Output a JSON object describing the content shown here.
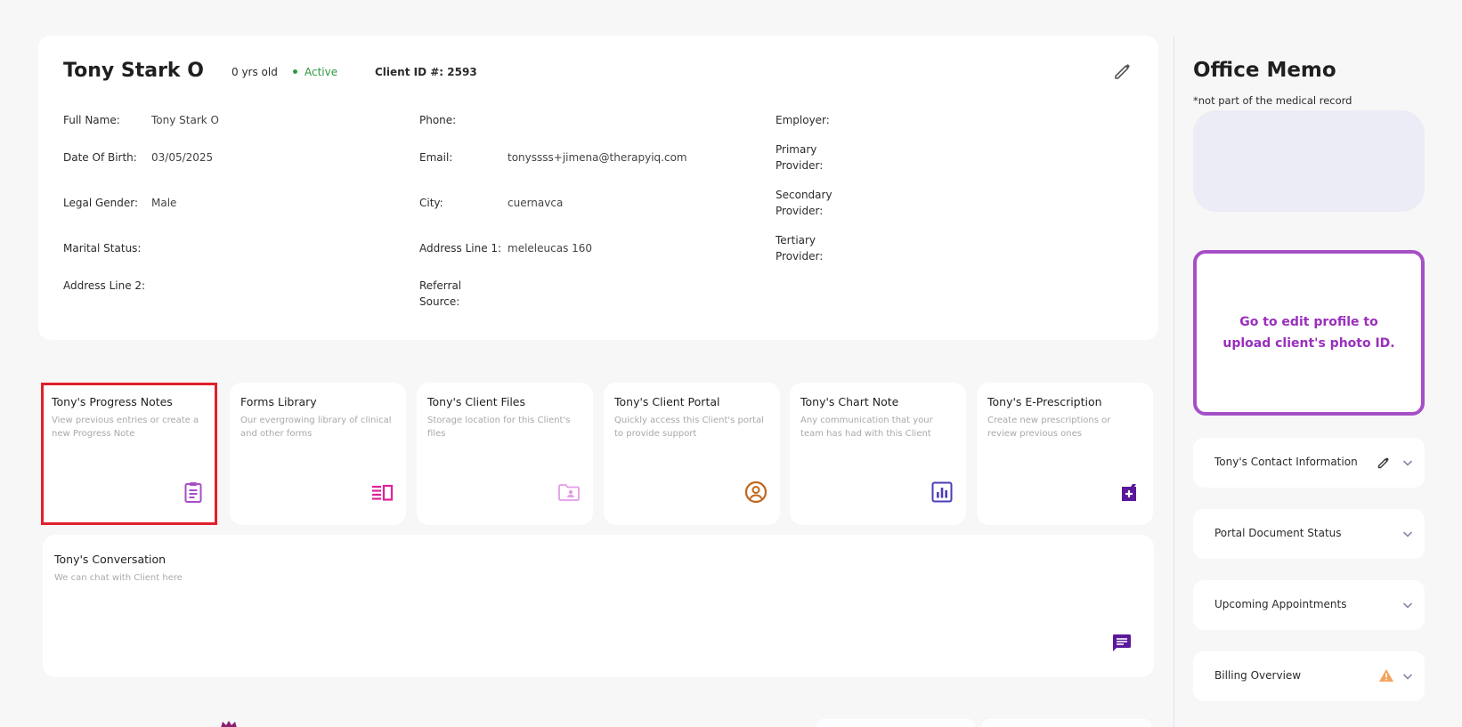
{
  "client": {
    "name": "Tony Stark O",
    "age": "0 yrs old",
    "status": "Active",
    "client_id_label": "Client ID #:",
    "client_id": "2593"
  },
  "fields": {
    "col1": [
      {
        "label": "Full Name:",
        "value": "Tony Stark O"
      },
      {
        "label": "Date Of Birth:",
        "value": "03/05/2025"
      },
      {
        "label": "Legal Gender:",
        "value": "Male"
      },
      {
        "label": "Marital Status:",
        "value": ""
      },
      {
        "label": "Address Line 2:",
        "value": ""
      }
    ],
    "col2": [
      {
        "label": "Phone:",
        "value": ""
      },
      {
        "label": "Email:",
        "value": "tonyssss+jimena@therapyiq.com"
      },
      {
        "label": "City:",
        "value": "cuernavca"
      },
      {
        "label": "Address Line 1:",
        "value": "meleleucas 160"
      },
      {
        "label": "Referral Source:",
        "value": ""
      }
    ],
    "col3": [
      {
        "label": "Employer:",
        "value": ""
      },
      {
        "label": "Primary\nProvider:",
        "value": ""
      },
      {
        "label": "Secondary\nProvider:",
        "value": ""
      },
      {
        "label": "Tertiary\nProvider:",
        "value": ""
      }
    ]
  },
  "tiles": [
    {
      "title": "Tony's Progress Notes",
      "desc": "View previous entries or create a new Progress Note",
      "icon": "clipboard-icon",
      "color": "#a64fc6"
    },
    {
      "title": "Forms Library",
      "desc": "Our evergrowing library of clinical and other forms",
      "icon": "forms-icon",
      "color": "#e0209a"
    },
    {
      "title": "Tony's Client Files",
      "desc": "Storage location for this Client's files",
      "icon": "folder-icon",
      "color": "#e49ce6"
    },
    {
      "title": "Tony's Client Portal",
      "desc": "Quickly access this Client's portal to provide support",
      "icon": "user-circle-icon",
      "color": "#c0661a"
    },
    {
      "title": "Tony's Chart Note",
      "desc": "Any communication that your team has had with this Client",
      "icon": "chart-icon",
      "color": "#4a3dbb"
    },
    {
      "title": "Tony's E-Prescription",
      "desc": "Create new prescriptions or review previous ones",
      "icon": "prescription-icon",
      "color": "#5a189a"
    }
  ],
  "conversation": {
    "title": "Tony's Conversation",
    "desc": "We can chat with Client here",
    "icon": "chat-icon",
    "color": "#5a189a"
  },
  "memo": {
    "title": "Office Memo",
    "note": "*not part of the medical record"
  },
  "photo": {
    "text": "Go to edit profile to upload client's photo ID."
  },
  "accordions": [
    {
      "label": "Tony's Contact Information",
      "extra": "pencil-icon"
    },
    {
      "label": "Portal Document Status",
      "extra": ""
    },
    {
      "label": "Upcoming Appointments",
      "extra": ""
    },
    {
      "label": "Billing Overview",
      "extra": "warning-icon"
    }
  ],
  "colors": {
    "accent_purple": "#9a2fbd",
    "status_green": "#2e9a3e",
    "highlight_red": "#e0202a",
    "warning_orange": "#f5a25d"
  }
}
